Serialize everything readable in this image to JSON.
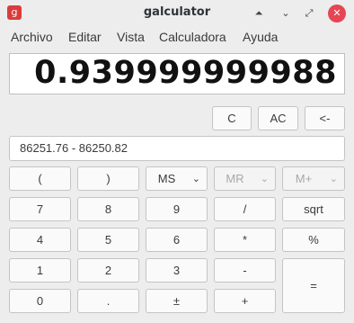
{
  "window": {
    "title": "galculator",
    "app_icon_glyph": "g",
    "buttons": {
      "shade": "⏶",
      "minimize": "⌄",
      "restore": "⤢",
      "close": "✕"
    },
    "close_color": "#e64553"
  },
  "menu": [
    "Archivo",
    "Editar",
    "Vista",
    "Calculadora",
    "Ayuda"
  ],
  "display": {
    "value": "0.939999999988"
  },
  "controls": {
    "clear": "C",
    "all_clear": "AC",
    "backspace": "<-"
  },
  "formula": "86251.76 - 86250.82",
  "memory": {
    "paren_open": "(",
    "paren_close": ")",
    "ms": "MS",
    "mr": "MR",
    "mplus": "M+",
    "chevron": "⌄"
  },
  "keypad": {
    "k7": "7",
    "k8": "8",
    "k9": "9",
    "div": "/",
    "sqrt": "sqrt",
    "k4": "4",
    "k5": "5",
    "k6": "6",
    "mul": "*",
    "pct": "%",
    "k1": "1",
    "k2": "2",
    "k3": "3",
    "sub": "-",
    "k0": "0",
    "dot": ".",
    "sign": "±",
    "add": "+",
    "eq": "="
  }
}
